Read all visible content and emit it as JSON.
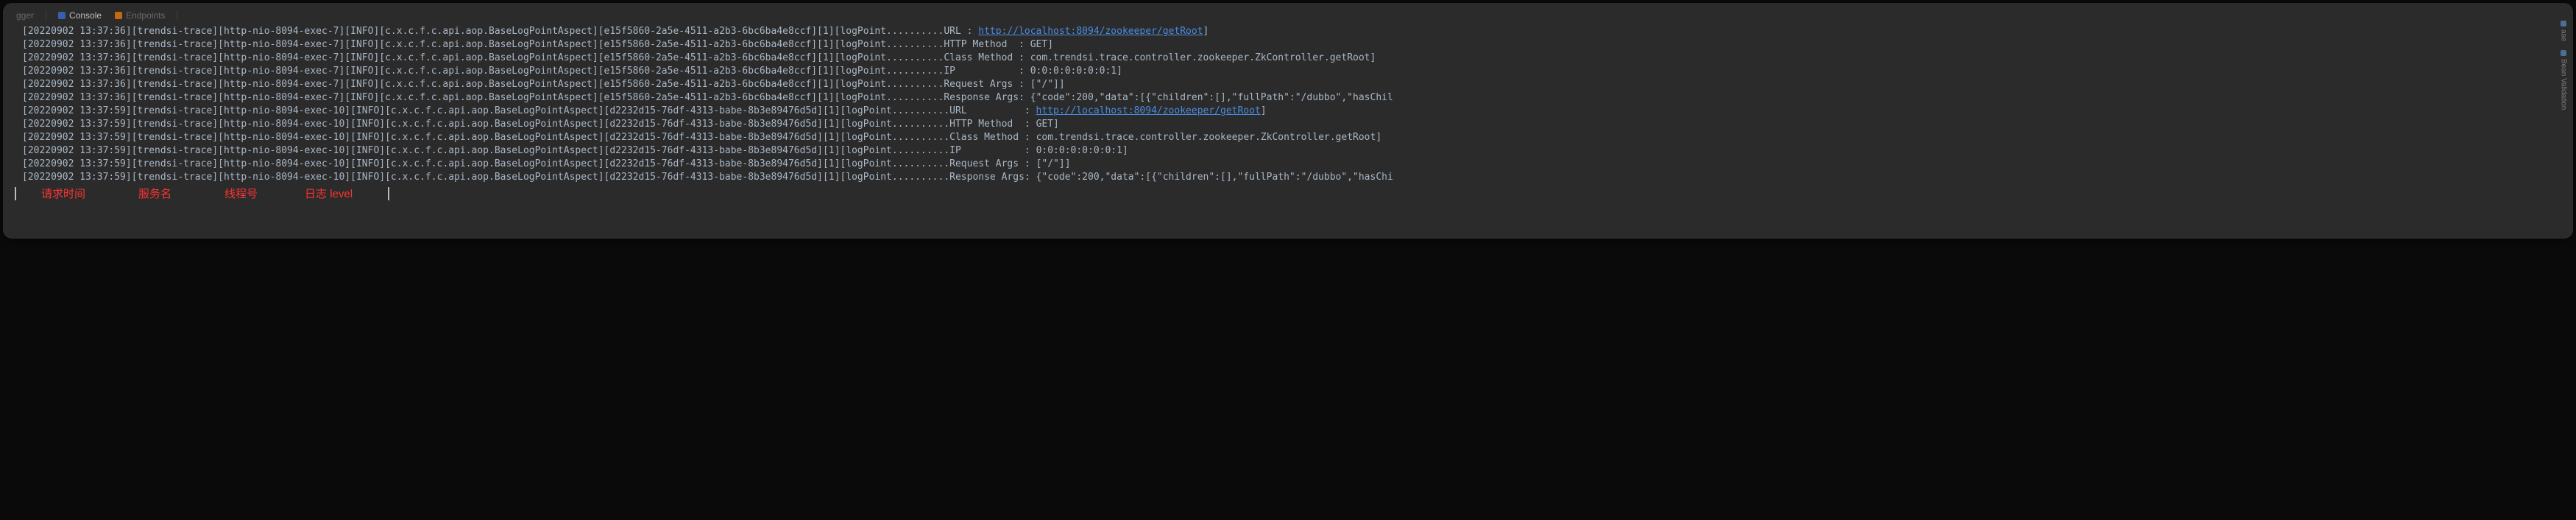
{
  "tabs": {
    "left": "gger",
    "console": "Console",
    "endpoints": "Endpoints"
  },
  "rail": {
    "item1": "ase",
    "item2": "Bean Validation"
  },
  "logs": [
    {
      "ts": "[20220902 13:37:36]",
      "svc": "[trendsi-trace]",
      "th": "[http-nio-8094-exec-7]",
      "lvl": "[INFO]",
      "cls": "[c.x.c.f.c.api.aop.BaseLogPointAspect]",
      "tid": "[e15f5860-2a5e-4511-a2b3-6bc6ba4e8ccf]",
      "idx": "[1]",
      "msg": "[logPoint..........URL",
      "sep": " : ",
      "val": "http://localhost:8094/zookeeper/getRoot",
      "tail": "]",
      "link": true
    },
    {
      "ts": "[20220902 13:37:36]",
      "svc": "[trendsi-trace]",
      "th": "[http-nio-8094-exec-7]",
      "lvl": "[INFO]",
      "cls": "[c.x.c.f.c.api.aop.BaseLogPointAspect]",
      "tid": "[e15f5860-2a5e-4511-a2b3-6bc6ba4e8ccf]",
      "idx": "[1]",
      "msg": "[logPoint..........HTTP Method",
      "sep": "  : ",
      "val": "GET]",
      "tail": "",
      "link": false
    },
    {
      "ts": "[20220902 13:37:36]",
      "svc": "[trendsi-trace]",
      "th": "[http-nio-8094-exec-7]",
      "lvl": "[INFO]",
      "cls": "[c.x.c.f.c.api.aop.BaseLogPointAspect]",
      "tid": "[e15f5860-2a5e-4511-a2b3-6bc6ba4e8ccf]",
      "idx": "[1]",
      "msg": "[logPoint..........Class Method",
      "sep": " : ",
      "val": "com.trendsi.trace.controller.zookeeper.ZkController.getRoot]",
      "tail": "",
      "link": false
    },
    {
      "ts": "[20220902 13:37:36]",
      "svc": "[trendsi-trace]",
      "th": "[http-nio-8094-exec-7]",
      "lvl": "[INFO]",
      "cls": "[c.x.c.f.c.api.aop.BaseLogPointAspect]",
      "tid": "[e15f5860-2a5e-4511-a2b3-6bc6ba4e8ccf]",
      "idx": "[1]",
      "msg": "[logPoint..........IP",
      "sep": "           : ",
      "val": "0:0:0:0:0:0:0:1]",
      "tail": "",
      "link": false
    },
    {
      "ts": "[20220902 13:37:36]",
      "svc": "[trendsi-trace]",
      "th": "[http-nio-8094-exec-7]",
      "lvl": "[INFO]",
      "cls": "[c.x.c.f.c.api.aop.BaseLogPointAspect]",
      "tid": "[e15f5860-2a5e-4511-a2b3-6bc6ba4e8ccf]",
      "idx": "[1]",
      "msg": "[logPoint..........Request Args",
      "sep": " : ",
      "val": "[\"/\"]]",
      "tail": "",
      "link": false
    },
    {
      "ts": "[20220902 13:37:36]",
      "svc": "[trendsi-trace]",
      "th": "[http-nio-8094-exec-7]",
      "lvl": "[INFO]",
      "cls": "[c.x.c.f.c.api.aop.BaseLogPointAspect]",
      "tid": "[e15f5860-2a5e-4511-a2b3-6bc6ba4e8ccf]",
      "idx": "[1]",
      "msg": "[logPoint..........Response Args",
      "sep": ": ",
      "val": "{\"code\":200,\"data\":[{\"children\":[],\"fullPath\":\"/dubbo\",\"hasChil",
      "tail": "",
      "link": false
    },
    {
      "ts": "[20220902 13:37:59]",
      "svc": "[trendsi-trace]",
      "th": "[http-nio-8094-exec-10]",
      "lvl": "[INFO]",
      "cls": "[c.x.c.f.c.api.aop.BaseLogPointAspect]",
      "tid": "[d2232d15-76df-4313-babe-8b3e89476d5d]",
      "idx": "[1]",
      "msg": "[logPoint..........URL",
      "sep": "          : ",
      "val": "http://localhost:8094/zookeeper/getRoot",
      "tail": "]",
      "link": true
    },
    {
      "ts": "[20220902 13:37:59]",
      "svc": "[trendsi-trace]",
      "th": "[http-nio-8094-exec-10]",
      "lvl": "[INFO]",
      "cls": "[c.x.c.f.c.api.aop.BaseLogPointAspect]",
      "tid": "[d2232d15-76df-4313-babe-8b3e89476d5d]",
      "idx": "[1]",
      "msg": "[logPoint..........HTTP Method",
      "sep": "  : ",
      "val": "GET]",
      "tail": "",
      "link": false
    },
    {
      "ts": "[20220902 13:37:59]",
      "svc": "[trendsi-trace]",
      "th": "[http-nio-8094-exec-10]",
      "lvl": "[INFO]",
      "cls": "[c.x.c.f.c.api.aop.BaseLogPointAspect]",
      "tid": "[d2232d15-76df-4313-babe-8b3e89476d5d]",
      "idx": "[1]",
      "msg": "[logPoint..........Class Method",
      "sep": " : ",
      "val": "com.trendsi.trace.controller.zookeeper.ZkController.getRoot]",
      "tail": "",
      "link": false
    },
    {
      "ts": "[20220902 13:37:59]",
      "svc": "[trendsi-trace]",
      "th": "[http-nio-8094-exec-10]",
      "lvl": "[INFO]",
      "cls": "[c.x.c.f.c.api.aop.BaseLogPointAspect]",
      "tid": "[d2232d15-76df-4313-babe-8b3e89476d5d]",
      "idx": "[1]",
      "msg": "[logPoint..........IP",
      "sep": "           : ",
      "val": "0:0:0:0:0:0:0:1]",
      "tail": "",
      "link": false
    },
    {
      "ts": "[20220902 13:37:59]",
      "svc": "[trendsi-trace]",
      "th": "[http-nio-8094-exec-10]",
      "lvl": "[INFO]",
      "cls": "[c.x.c.f.c.api.aop.BaseLogPointAspect]",
      "tid": "[d2232d15-76df-4313-babe-8b3e89476d5d]",
      "idx": "[1]",
      "msg": "[logPoint..........Request Args",
      "sep": " : ",
      "val": "[\"/\"]]",
      "tail": "",
      "link": false
    },
    {
      "ts": "[20220902 13:37:59]",
      "svc": "[trendsi-trace]",
      "th": "[http-nio-8094-exec-10]",
      "lvl": "[INFO]",
      "cls": "[c.x.c.f.c.api.aop.BaseLogPointAspect]",
      "tid": "[d2232d15-76df-4313-babe-8b3e89476d5d]",
      "idx": "[1]",
      "msg": "[logPoint..........Response Args",
      "sep": ": ",
      "val": "{\"code\":200,\"data\":[{\"children\":[],\"fullPath\":\"/dubbo\",\"hasChi",
      "tail": "",
      "link": false
    }
  ],
  "annotations": {
    "a1": "请求时间",
    "a2": "服务名",
    "a3": "线程号",
    "a4": "日志 level"
  }
}
